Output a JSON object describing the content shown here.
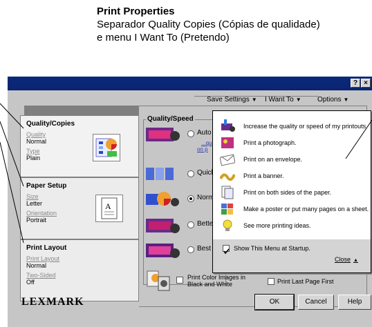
{
  "caption": {
    "title": "Print Properties",
    "line1": "Separador Quality Copies (Cópias de qualidade)",
    "line2": "e menu I Want To (Pretendo)"
  },
  "window": {
    "title_buttons": [
      "?",
      "×"
    ],
    "menubar": {
      "save_settings": "Save Settings",
      "i_want_to": "I Want To",
      "options": "Options"
    }
  },
  "tabs": {
    "quality_copies": {
      "title": "Quality/Copies",
      "rows": [
        {
          "label": "Quality",
          "value": "Normal"
        },
        {
          "label": "Type",
          "value": "Plain"
        }
      ]
    },
    "paper_setup": {
      "title": "Paper Setup",
      "rows": [
        {
          "label": "Size",
          "value": "Letter"
        },
        {
          "label": "Orientation",
          "value": "Portrait"
        }
      ]
    },
    "print_layout": {
      "title": "Print Layout",
      "rows": [
        {
          "label": "Print Layout",
          "value": "Normal"
        },
        {
          "label": "Two-Sided",
          "value": "Off"
        }
      ]
    }
  },
  "quality_speed": {
    "title": "Quality/Speed",
    "options": [
      "Auto",
      "Quick Print",
      "Normal",
      "Better",
      "Best"
    ],
    "selected": "Normal",
    "auto_link": [
      "...qu",
      "on p"
    ]
  },
  "checkboxes": {
    "color_black_white": "Print Color Images in Black and White",
    "last_page_first": "Print Last Page First"
  },
  "popup": {
    "items": [
      "Increase the quality or speed of my printouts.",
      "Print a photograph.",
      "Print on an envelope.",
      "Print a banner.",
      "Print on both sides of the paper.",
      "Make a poster or put many pages on a sheet.",
      "See more printing ideas."
    ],
    "show_menu": "Show This Menu at Startup.",
    "close": "Close"
  },
  "footer": {
    "logo": "LEXMARK",
    "ok": "OK",
    "cancel": "Cancel",
    "help": "Help"
  },
  "colors": {
    "titlebar": "#0a2470",
    "link": "#2a3ab0"
  }
}
